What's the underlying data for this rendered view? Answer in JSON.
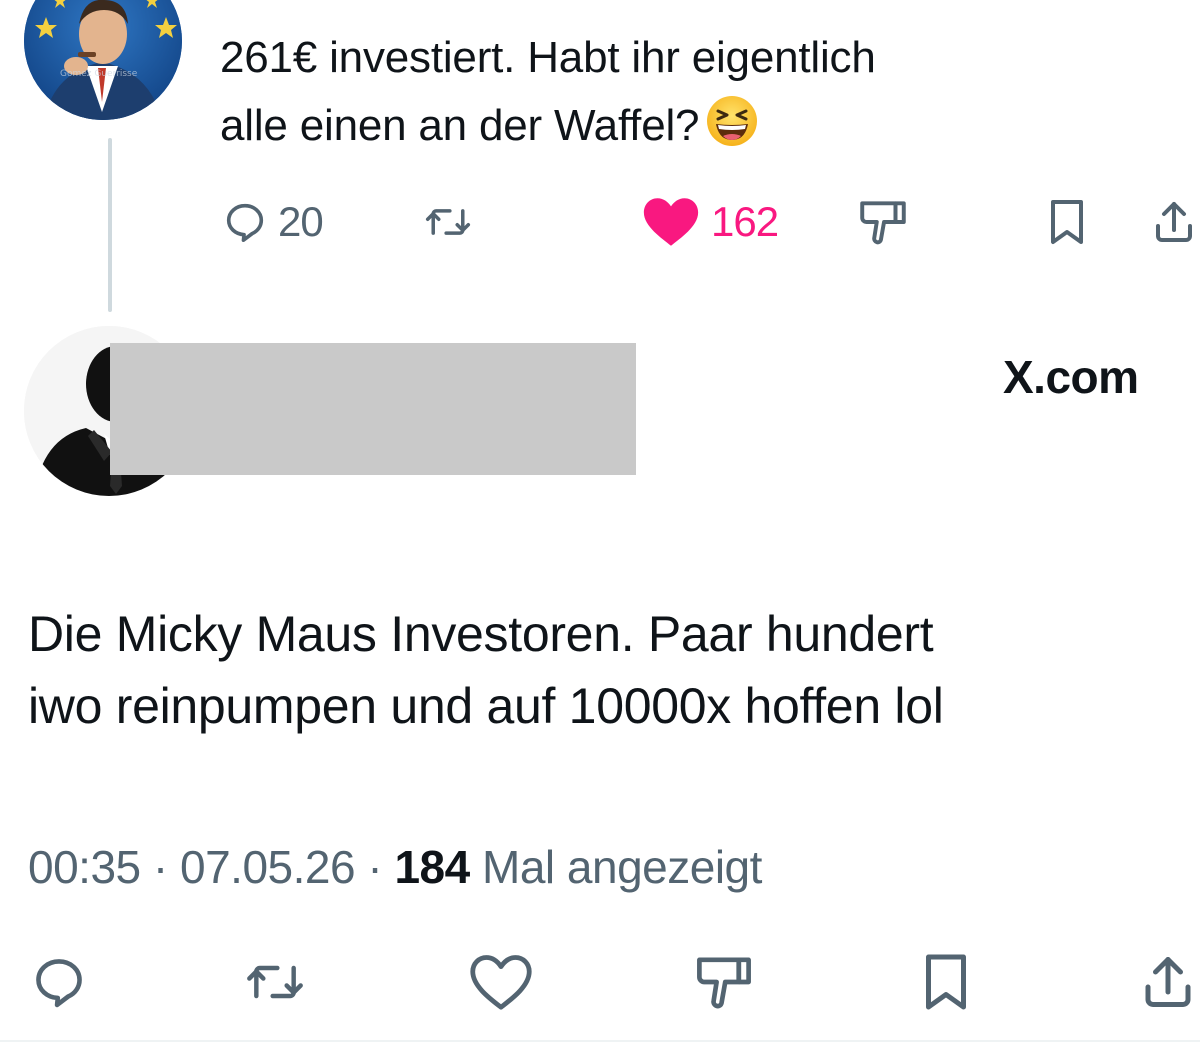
{
  "parent_tweet": {
    "text_line1": "261€ investiert. Habt ihr eigentlich",
    "text_line2": "alle einen an der Waffel?",
    "emoji_icon": "grinning-squinting-face-emoji",
    "actions": {
      "reply_count": "20",
      "retweet_count": "",
      "like_count": "162",
      "liked": true
    }
  },
  "main_tweet": {
    "username_redacted": true,
    "brand": "X.com",
    "text_line1": "Die Micky Maus Investoren. Paar hundert",
    "text_line2": "iwo reinpumpen und auf 10000x hoffen lol",
    "meta": {
      "time": "00:35",
      "separator": "·",
      "date": "07.05.26",
      "views_count": "184",
      "views_label": "Mal angezeigt"
    },
    "actions": [
      "reply-icon",
      "retweet-icon",
      "like-icon",
      "dislike-icon",
      "bookmark-icon",
      "share-icon"
    ]
  },
  "colors": {
    "text_primary": "#0f1419",
    "text_secondary": "#536471",
    "like_pink": "#f91880",
    "thread_line": "#cfd9de",
    "redaction": "#c9c9c9"
  }
}
